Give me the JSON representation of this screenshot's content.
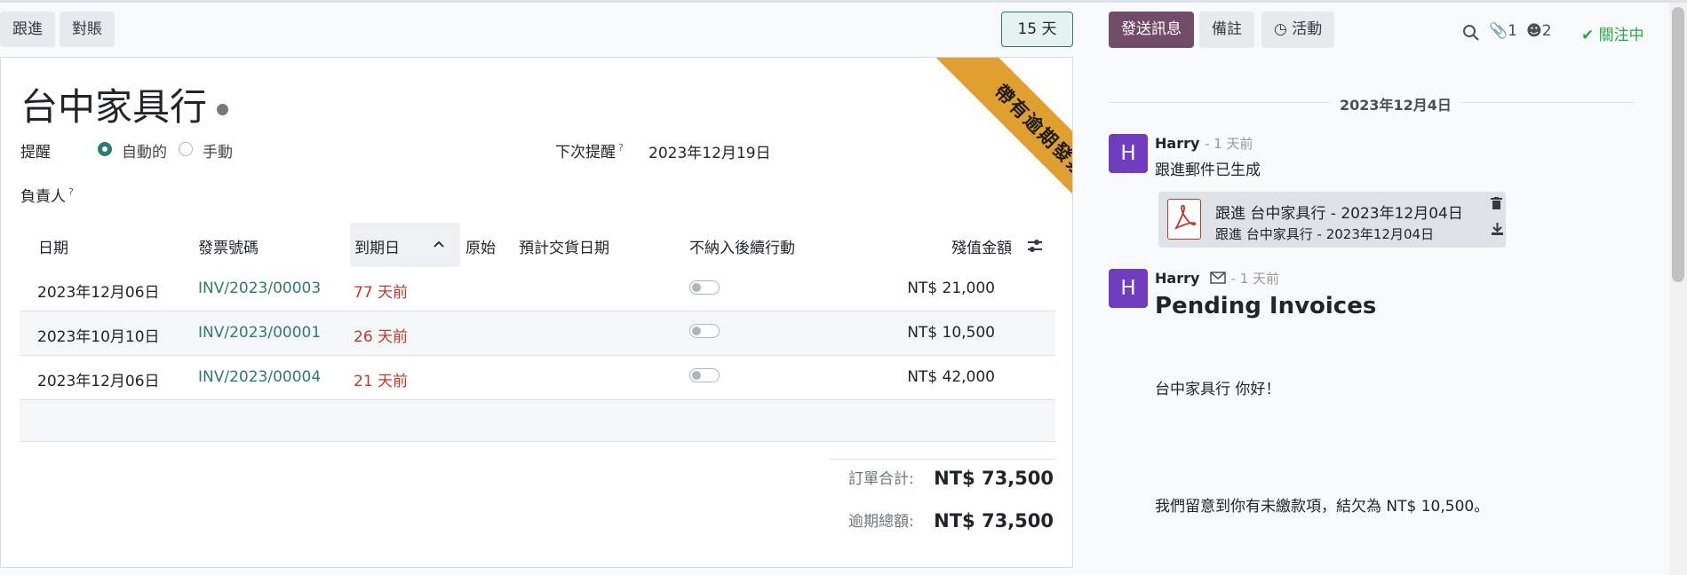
{
  "toolbar": {
    "followup_label": "跟進",
    "reconcile_label": "對賬",
    "days_label": "15 天"
  },
  "sheet": {
    "ribbon": "帶有逾期發票",
    "partner_name": "台中家具行",
    "reminder_label": "提醒",
    "reminder_options": [
      "自動的",
      "手動"
    ],
    "reminder_selected": "自動的",
    "next_reminder_label": "下次提醒",
    "next_reminder_value": "2023年12月19日",
    "responsible_label": "負責人",
    "help_mark": "?"
  },
  "table": {
    "columns": [
      "日期",
      "發票號碼",
      "到期日",
      "原始",
      "預計交貨日期",
      "不納入後續行動",
      "殘值金額"
    ],
    "sorted_column": "到期日",
    "rows": [
      {
        "date": "2023年12月06日",
        "invoice": "INV/2023/00003",
        "due": "77 天前",
        "excluded": false,
        "amount": "NT$ 21,000"
      },
      {
        "date": "2023年10月10日",
        "invoice": "INV/2023/00001",
        "due": "26 天前",
        "excluded": false,
        "amount": "NT$ 10,500"
      },
      {
        "date": "2023年12月06日",
        "invoice": "INV/2023/00004",
        "due": "21 天前",
        "excluded": false,
        "amount": "NT$ 42,000"
      }
    ],
    "total_label": "訂單合計:",
    "total_value": "NT$ 73,500",
    "overdue_label": "逾期總額:",
    "overdue_value": "NT$ 73,500"
  },
  "chatter": {
    "send_message_label": "發送訊息",
    "note_label": "備註",
    "activity_label": "活動",
    "attachment_count": "1",
    "follower_count": "2",
    "following_label": "關注中",
    "date_separator": "2023年12月4日",
    "messages": [
      {
        "avatar": "H",
        "author": "Harry",
        "ago": "- 1 天前",
        "body": "跟進郵件已生成",
        "attachment_title": "跟進 台中家具行 - 2023年12月04日",
        "attachment_name": "跟進 台中家具行 - 2023年12月04日"
      },
      {
        "avatar": "H",
        "author": "Harry",
        "ago": "- 1 天前",
        "heading": "Pending Invoices",
        "greeting": "台中家具行 你好！",
        "body": "我們留意到你有未繳款項，結欠為 NT$ 10,500。"
      }
    ]
  },
  "colors": {
    "accent": "#2f7a75",
    "primary_button": "#714b67",
    "ribbon": "#e09f30",
    "late": "#c0392b",
    "avatar": "#6f3dbd",
    "following": "#28a745"
  }
}
